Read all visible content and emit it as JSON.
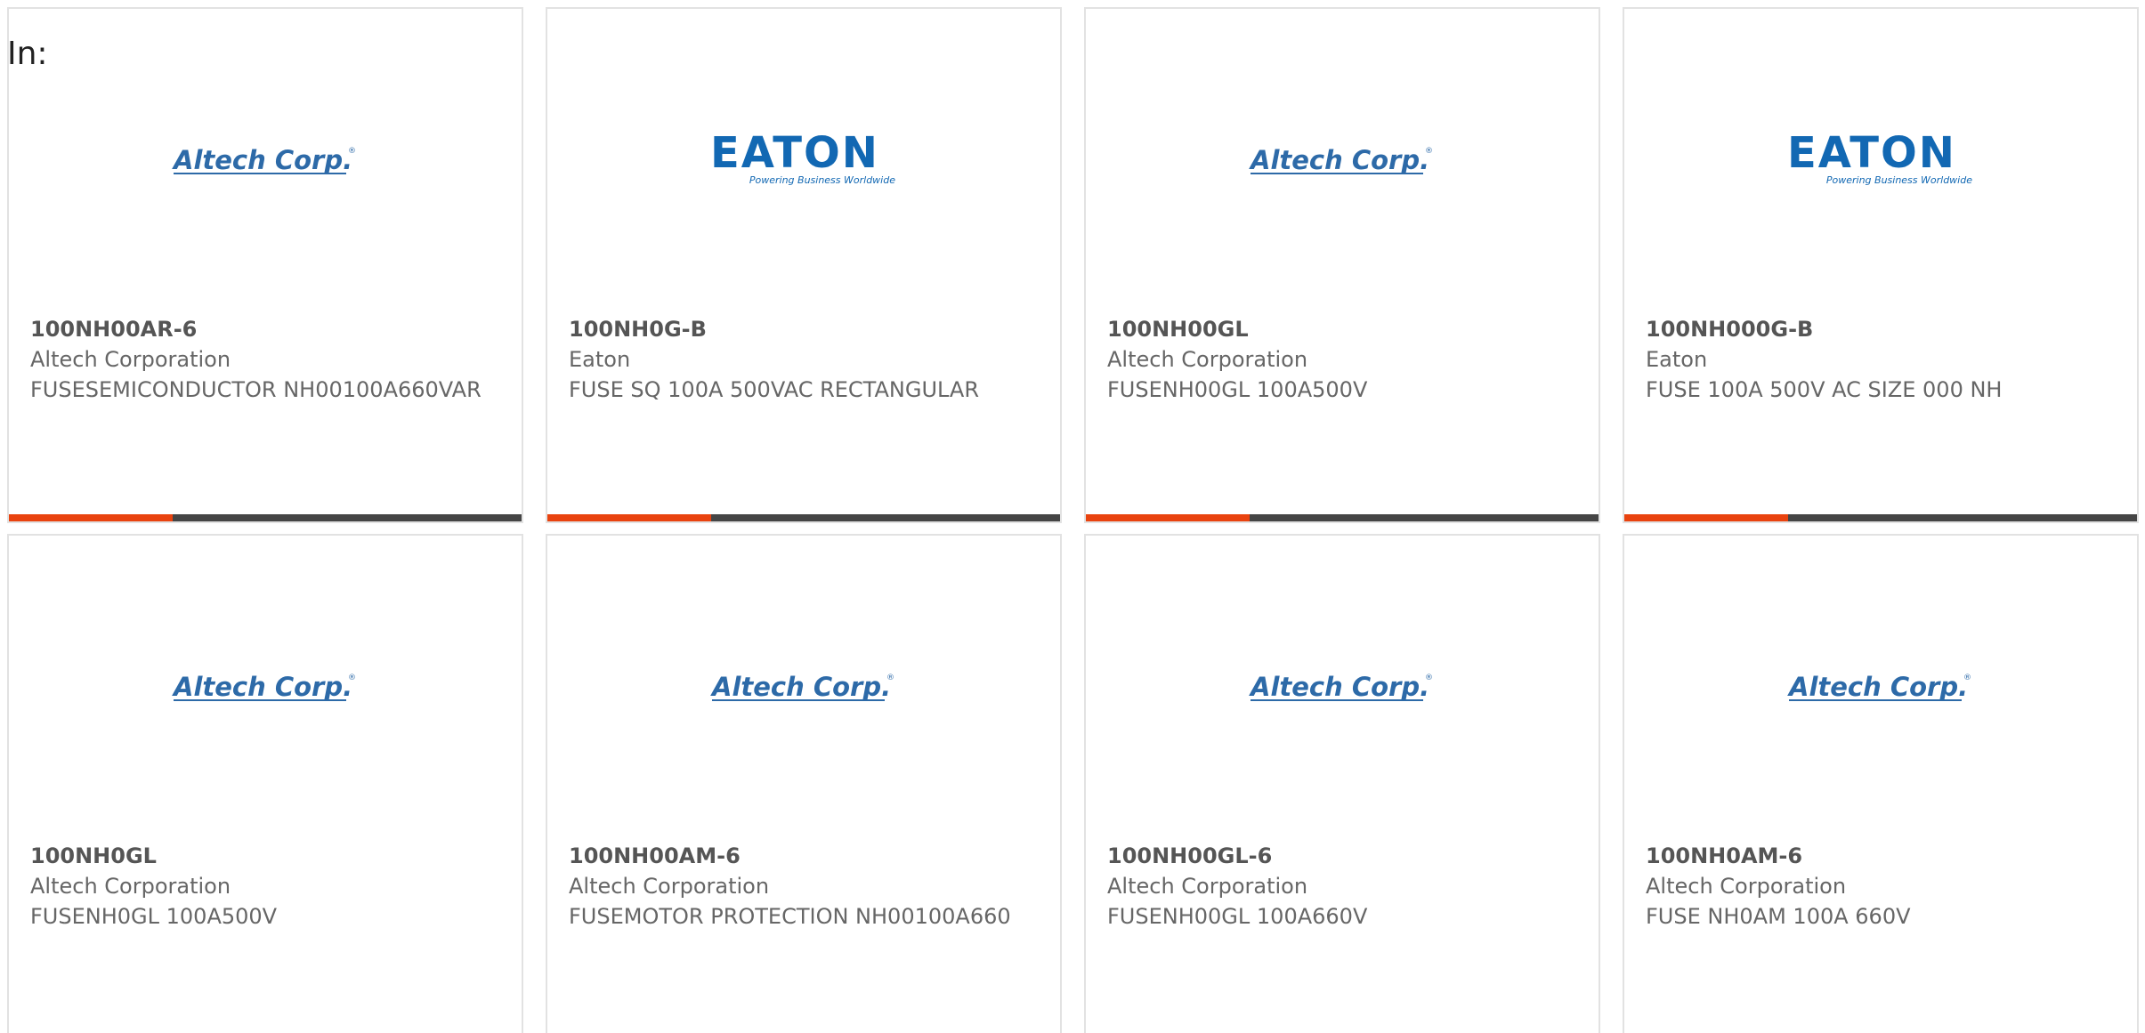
{
  "filter": {
    "in_label": "In:"
  },
  "accent_color": "#e9430f",
  "bar_color": "#454545",
  "products": [
    {
      "part_number": "100NH00AR-6",
      "manufacturer": "Altech Corporation",
      "description": "FUSESEMICONDUCTOR NH00100A660VAR",
      "logo": {
        "name": "altech-logo",
        "text": "Altech Corp.",
        "mark": "®"
      }
    },
    {
      "part_number": "100NH0G-B",
      "manufacturer": "Eaton",
      "description": "FUSE SQ 100A 500VAC RECTANGULAR",
      "logo": {
        "name": "eaton-logo",
        "text": "EATON",
        "tagline": "Powering Business Worldwide"
      }
    },
    {
      "part_number": "100NH00GL",
      "manufacturer": "Altech Corporation",
      "description": "FUSENH00GL 100A500V",
      "logo": {
        "name": "altech-logo",
        "text": "Altech Corp.",
        "mark": "®"
      }
    },
    {
      "part_number": "100NH000G-B",
      "manufacturer": "Eaton",
      "description": "FUSE 100A 500V AC SIZE 000 NH",
      "logo": {
        "name": "eaton-logo",
        "text": "EATON",
        "tagline": "Powering Business Worldwide"
      }
    },
    {
      "part_number": "100NH0GL",
      "manufacturer": "Altech Corporation",
      "description": "FUSENH0GL 100A500V",
      "logo": {
        "name": "altech-logo",
        "text": "Altech Corp.",
        "mark": "®"
      }
    },
    {
      "part_number": "100NH00AM-6",
      "manufacturer": "Altech Corporation",
      "description": "FUSEMOTOR PROTECTION NH00100A660",
      "logo": {
        "name": "altech-logo",
        "text": "Altech Corp.",
        "mark": "®"
      }
    },
    {
      "part_number": "100NH00GL-6",
      "manufacturer": "Altech Corporation",
      "description": "FUSENH00GL 100A660V",
      "logo": {
        "name": "altech-logo",
        "text": "Altech Corp.",
        "mark": "®"
      }
    },
    {
      "part_number": "100NH0AM-6",
      "manufacturer": "Altech Corporation",
      "description": "FUSE NH0AM 100A 660V",
      "logo": {
        "name": "altech-logo",
        "text": "Altech Corp.",
        "mark": "®"
      }
    }
  ]
}
